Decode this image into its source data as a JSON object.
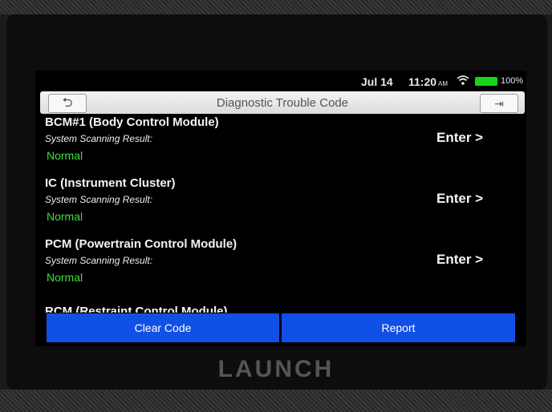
{
  "statusbar": {
    "date": "Jul 14",
    "time": "11:20",
    "ampm": "AM",
    "battery_pct": "100%",
    "wifi_icon": "wifi-icon",
    "battery_color": "#19d21c"
  },
  "header": {
    "title": "Diagnostic Trouble Code",
    "back_icon": "back-arrow-icon",
    "exit_icon": "exit-icon",
    "back_glyph": "⮌",
    "exit_glyph": "⇥"
  },
  "modules": [
    {
      "name": "BCM#1 (Body Control Module)",
      "label": "System Scanning Result:",
      "result": "Normal",
      "enter": "Enter >"
    },
    {
      "name": "IC (Instrument Cluster)",
      "label": "System Scanning Result:",
      "result": "Normal",
      "enter": "Enter >"
    },
    {
      "name": "PCM (Powertrain Control Module)",
      "label": "System Scanning Result:",
      "result": "Normal",
      "enter": "Enter >"
    },
    {
      "name": "RCM (Restraint Control Module)"
    }
  ],
  "actions": {
    "clear_code": "Clear Code",
    "report": "Report",
    "accent": "#1150e6"
  },
  "device": {
    "brand": "LAUNCH"
  }
}
